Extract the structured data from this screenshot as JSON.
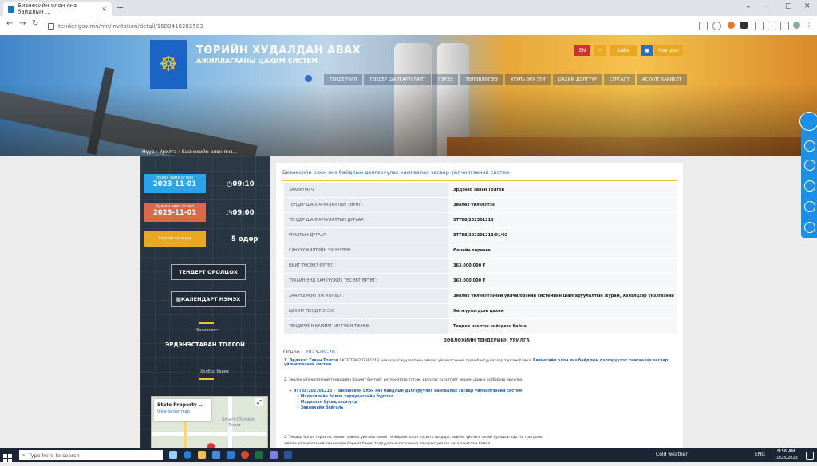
{
  "browser": {
    "tab_title": "Бизнесийн олон янз байдлын ...",
    "tab_close": "×",
    "new_tab": "+",
    "url": "tender.gov.mn/mn/invitation/detail/1689410282583",
    "window_controls": [
      "⌄",
      "–",
      "□",
      "✕"
    ]
  },
  "header": {
    "brand_line1": "ТӨРИЙН ХУДАЛДАН АВАХ",
    "brand_line2": "АЖИЛЛАГААНЫ ЦАХИМ СИСТЕМ",
    "search_label": "Хайх",
    "login_label": "Нэвтрэх",
    "menu": [
      "ТЕНДЕРЧИЛ",
      "ТЕНДЕР ШАЛГАРУУЛАЛТ",
      "ГЭРЭЭ",
      "ТӨЛӨВЛӨГӨӨ",
      "ХУУЛЬ ЭРХ ЗҮЙ",
      "ЦАХИМ ДЭЛГҮҮР",
      "СУРГАЛТ",
      "АСУУЛТ ХАРИУЛТ"
    ],
    "breadcrumb": "Нүүр › Урилга › Бизнесийн олон янз..."
  },
  "sidebar": {
    "start_label": "Эхлэх хийх огноо",
    "start_date": "2023-11-01",
    "start_time": "09:10",
    "end_label": "Хүлээн авах огноо",
    "end_date": "2023-11-01",
    "end_time": "09:00",
    "remaining_label": "Үлдсэн хугацаа",
    "remaining_value": "5 өдөр",
    "join_button": "ТЕНДЕРТ ОРОЛЦОХ",
    "calendar_button": "КАЛЕНДАРТ НЭМЭХ",
    "org_caption": "Захиалагч",
    "org_name": "ЭРДЭНЭСТАВАН ТОЛГОЙ",
    "contact_caption": "Холбоо барих"
  },
  "map": {
    "title": "State Property ...",
    "link": "View larger map",
    "label1": "Smart Chinggis",
    "label2": "Tower"
  },
  "details": {
    "title": "Бизнесийн олон янз байдлын дэлгэрүүлэх хамгаалах засвар үйлчилгээний систем",
    "rows": [
      {
        "k": "ЗАХИАЛАГЧ:",
        "v": "Эрдэнэс Таван Толгой"
      },
      {
        "k": "ТЕНДЕР ШАЛГАРУУЛАЛТЫН ТӨРӨЛ:",
        "v": "Зөвлөх үйлчилгээ"
      },
      {
        "k": "ТЕНДЕР ШАЛГАРУУЛАЛТЫН ДУГААР:",
        "v": "ЭТТ88/202301213"
      },
      {
        "k": "УРИЛГЫН ДУГААР:",
        "v": "ЭТТ88/202301213/01/02"
      },
      {
        "k": "САНХҮҮЖИЛТИЙН ЭХ ҮҮСВЭР:",
        "v": "Өөрийн хөрөнгө"
      },
      {
        "k": "НИЙТ ТӨСӨВТ ӨРТӨГ:",
        "v": "363,000,000 ₮"
      },
      {
        "k": "ТУХАЙН ЭНД САНХҮҮЖИХ ТӨСӨВТ ӨРТӨГ:",
        "v": "363,000,000 ₮"
      },
      {
        "k": "ХАА-НЫ МЭРГЭЖ ХОЛБОГ:",
        "v": "Зөвлөх үйлчилгээний үйлчилгээний системийн шалгаруулалтын журам, Хэлэлцээр үнэлгээний арга"
      },
      {
        "k": "ЦАХИМ ТЕНДЕР ЭСЭХ:",
        "v": "Хөгжүүлэгдсэн цахим"
      },
      {
        "k": "ТЕНДЕРИЙН БАРИМТ БИЧГИЙН ТӨЛӨВ:",
        "v": "Тендер нээлтээ хийгдсэн байна"
      }
    ],
    "section_heading": "ЗӨВЛӨХИЙН ТЕНДЕРИЙН УРИЛГА",
    "date_label": "Огноо :",
    "date_value": "2023-09-28",
    "para1_a": "1. Эрдэнэс Таван Толгой",
    "para1_b": "ХК ЭТТ88/202301213 -ийн хэрэгжүүлэлтийн зөвлөх үйлчилгээний гэрээ байгуулахаар зарлаж байна.",
    "para1_link": "Бизнесийн олон янз байдлын дэлгэрүүлэх хамгаалах засвар үйлчилгээний систем",
    "para2": "2. Зөвлөх үйлчилгээний тендерийн баримт бичгийг интернэтээр татаж, ирүүлэх хүсэлтийг зөвхөн цахим хэлбэрээр ирүүлнэ.",
    "list_head": "ЭТТ88/202301213 - \"Бизнесийн олон янз байдлын дэлгэрүүлэх хамгаалах засвар үйлчилгээний систем\"",
    "list_items": [
      "Мэдээллийн болон хариуцагчийн бүртгэл",
      "Мэдээлэл бусад хэсэгүүд",
      "Зөвлөхийн байгаль"
    ],
    "para3": "3. Тендер болон гэрээ нь зөвхөн зөвлөх үйлчилгээний төлбөрийг олон улсын стандарт, зөвлөх үйлчилгээний хугацаагаар тогтоогдоно.",
    "para4": "зөвлөх үйлчилгээний тендерийн баримт бичиг тодруулгын хугацаанд Чанарыг үнэлэх арга ажиглаж байна."
  },
  "taskbar": {
    "search_placeholder": "Type here to search",
    "weather": "Cold weather",
    "lang": "ENG",
    "time": "8:56 AM",
    "date": "10/25/2023"
  },
  "colors": {
    "accent": "#1d8fe6",
    "start_box": "#2aa3e8",
    "end_box": "#d86a4a",
    "remaining_box": "#e8a820",
    "panel_bg": "#243240",
    "title_blue": "#2a64b0",
    "yellow_line": "#e8c23a"
  }
}
